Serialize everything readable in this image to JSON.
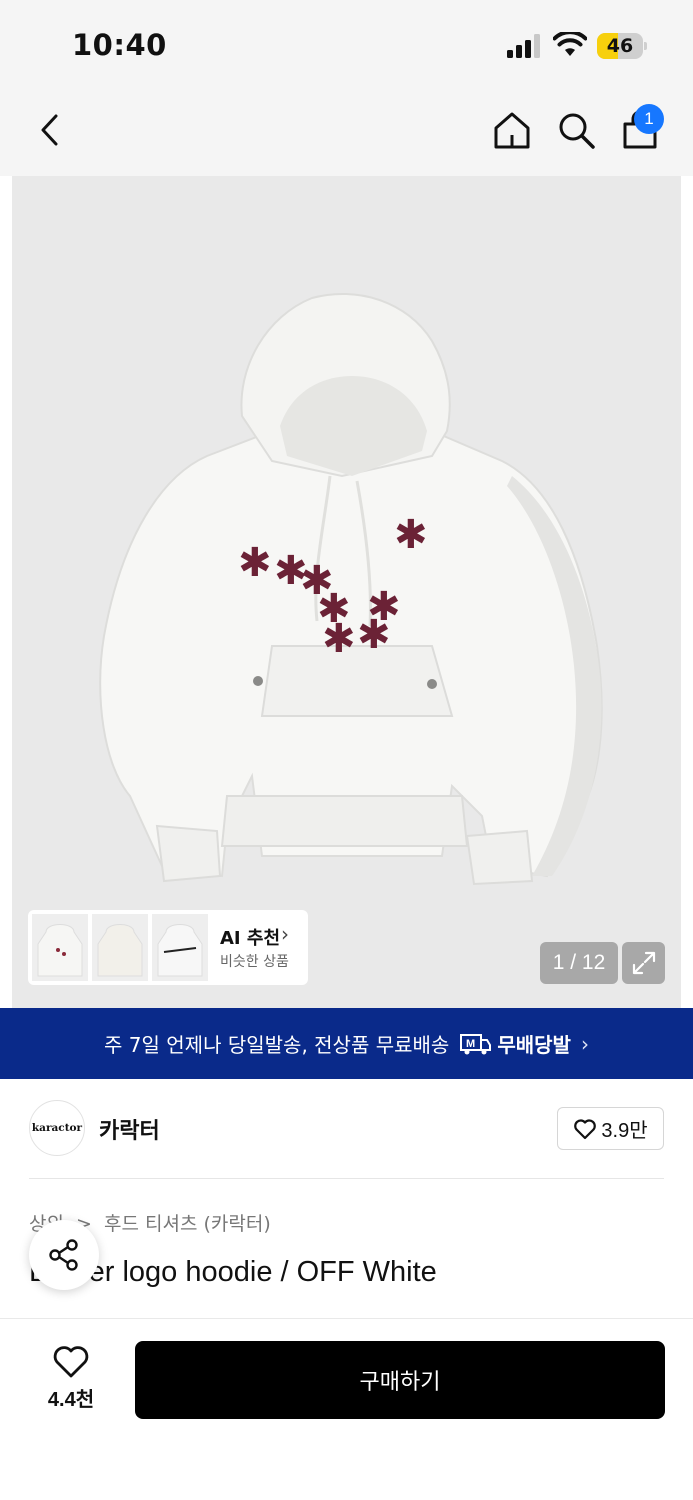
{
  "status_bar": {
    "time": "10:40",
    "battery_level": "46",
    "battery_fraction": 0.46
  },
  "nav": {
    "cart_count": "1"
  },
  "gallery": {
    "page_counter": "1 / 12",
    "ai_recommend": {
      "title": "AI 추천",
      "subtitle": "비슷한 상품"
    }
  },
  "shipping_banner": {
    "text": "주 7일 언제나 당일발송, 전상품 무료배송",
    "brand_label": "무배당발",
    "brand_mark": "M"
  },
  "brand": {
    "logo_text": "karactor",
    "name": "카락터",
    "likes": "3.9만"
  },
  "product": {
    "breadcrumb": [
      "상의",
      "후드 티셔츠 (카락터)"
    ],
    "breadcrumb_separator": ">",
    "title": "Dipper logo hoodie / OFF White"
  },
  "bottom_bar": {
    "wish_count": "4.4천",
    "buy_label": "구매하기"
  },
  "colors": {
    "banner": "#0a2a8a",
    "badge": "#1677ff",
    "battery": "#f7d00d",
    "buy_button": "#000000",
    "star_print": "#6b2236"
  }
}
